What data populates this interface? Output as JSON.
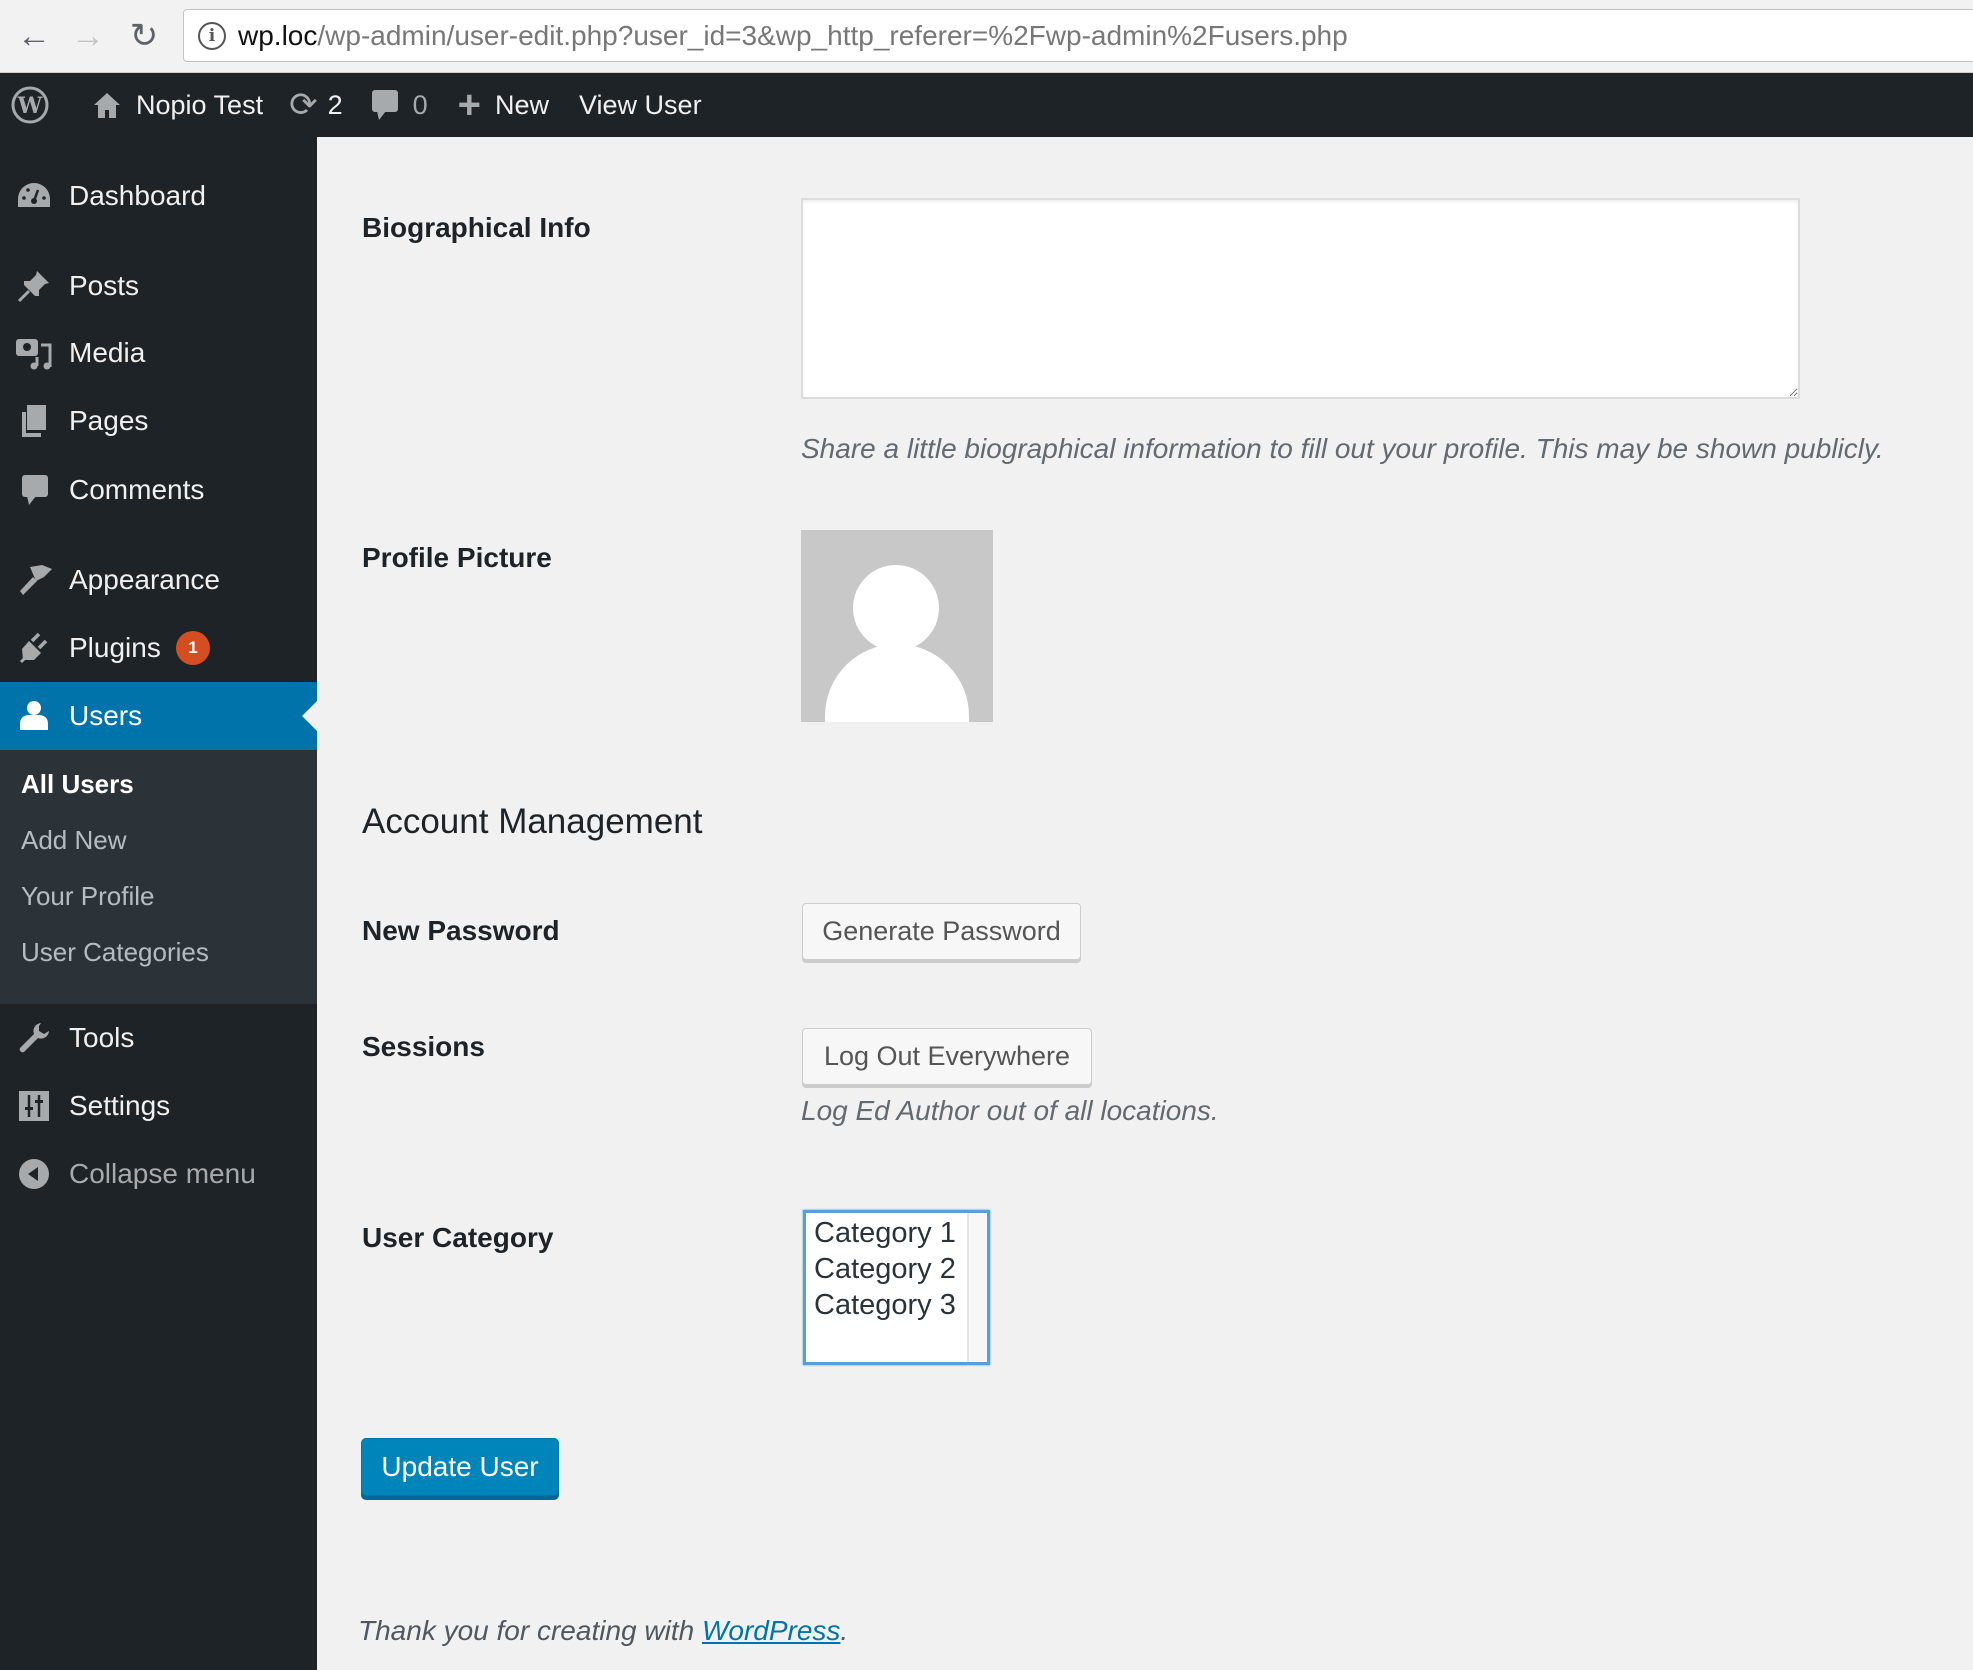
{
  "browser": {
    "url_host": "wp.loc",
    "url_path": "/wp-admin/user-edit.php?user_id=3&wp_http_referer=%2Fwp-admin%2Fusers.php",
    "icons": {
      "back": "arrow-left-icon",
      "forward": "arrow-right-icon",
      "reload": "reload-icon",
      "info": "info-icon"
    }
  },
  "admin_bar": {
    "site_name": "Nopio Test",
    "updates_count": "2",
    "comments_count": "0",
    "new_label": "New",
    "view_user_label": "View User"
  },
  "sidebar": {
    "items": [
      {
        "label": "Dashboard",
        "icon": "dashboard-icon"
      },
      {
        "label": "Posts",
        "icon": "pushpin-icon"
      },
      {
        "label": "Media",
        "icon": "media-icon"
      },
      {
        "label": "Pages",
        "icon": "pages-icon"
      },
      {
        "label": "Comments",
        "icon": "comment-icon"
      },
      {
        "label": "Appearance",
        "icon": "paintbrush-icon"
      },
      {
        "label": "Plugins",
        "icon": "plugin-icon",
        "badge": "1"
      },
      {
        "label": "Users",
        "icon": "user-icon",
        "active": true
      },
      {
        "label": "Tools",
        "icon": "wrench-icon"
      },
      {
        "label": "Settings",
        "icon": "settings-icon"
      }
    ],
    "submenu": [
      {
        "label": "All Users",
        "current": true
      },
      {
        "label": "Add New"
      },
      {
        "label": "Your Profile"
      },
      {
        "label": "User Categories"
      }
    ],
    "collapse_label": "Collapse menu"
  },
  "form": {
    "bio_label": "Biographical Info",
    "bio_value": "",
    "bio_help": "Share a little biographical information to fill out your profile. This may be shown publicly.",
    "profile_picture_label": "Profile Picture",
    "account_heading": "Account Management",
    "new_password_label": "New Password",
    "generate_password_button": "Generate Password",
    "sessions_label": "Sessions",
    "logout_button": "Log Out Everywhere",
    "logout_help": "Log Ed Author out of all locations.",
    "user_category_label": "User Category",
    "categories": [
      "Category 1",
      "Category 2",
      "Category 3"
    ],
    "submit_button": "Update User"
  },
  "footer": {
    "text": "Thank you for creating with ",
    "link": "WordPress",
    "suffix": "."
  },
  "colors": {
    "admin_bar": "#1d2327",
    "active_menu": "#0073aa",
    "primary_button": "#0085ba",
    "badge": "#d54e21"
  }
}
